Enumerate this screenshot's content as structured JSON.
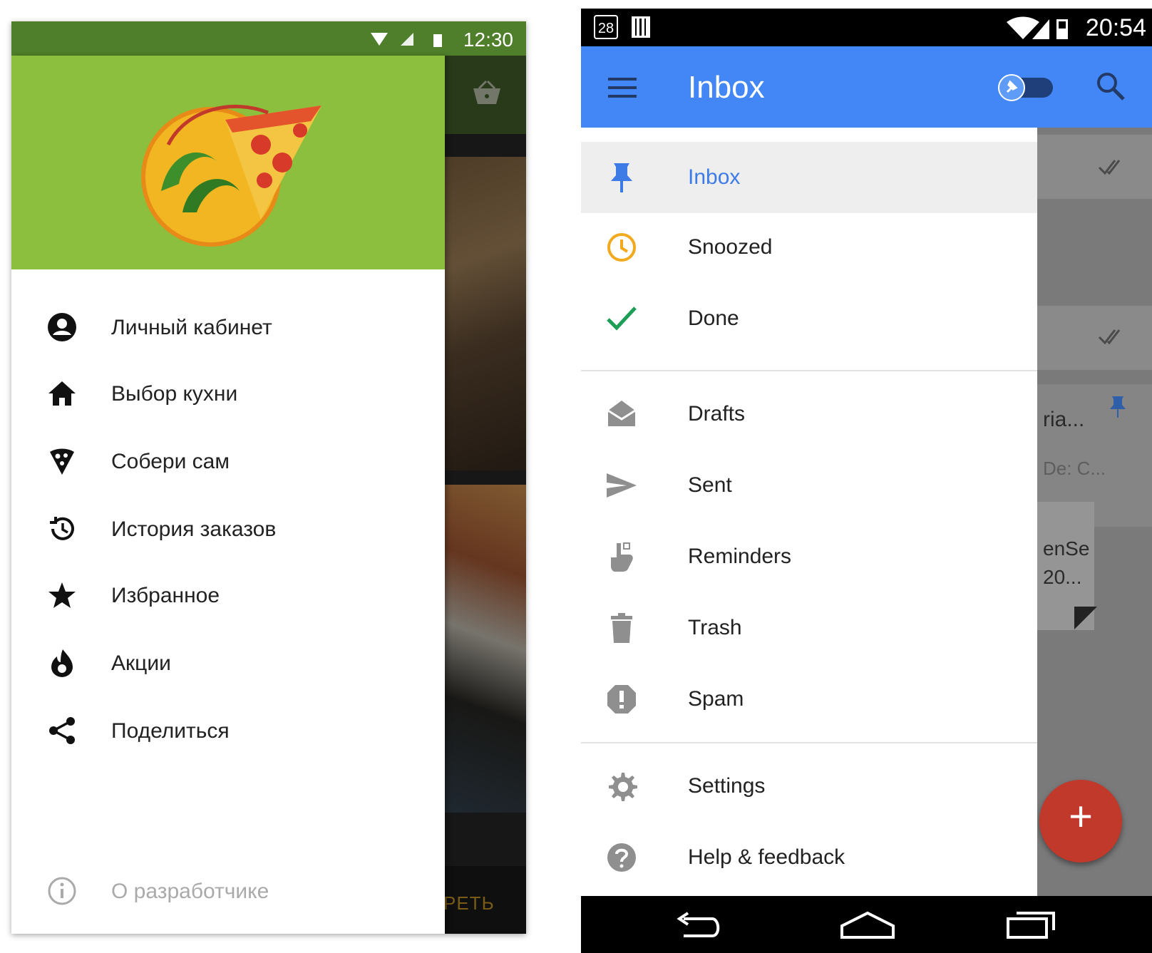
{
  "left_app": {
    "status_time": "12:30",
    "menu": [
      {
        "label": "Личный кабинет",
        "icon": "account-circle-icon"
      },
      {
        "label": "Выбор кухни",
        "icon": "home-icon"
      },
      {
        "label": "Собери сам",
        "icon": "pizza-slice-icon"
      },
      {
        "label": "История заказов",
        "icon": "history-icon"
      },
      {
        "label": "Избранное",
        "icon": "star-icon"
      },
      {
        "label": "Акции",
        "icon": "fire-icon"
      },
      {
        "label": "Поделиться",
        "icon": "share-icon"
      }
    ],
    "about_label": "О разработчике",
    "background_button_text": "РЕТЬ",
    "colors": {
      "header": "#8bbf3d",
      "statusbar": "#4f7f2a"
    }
  },
  "right_app": {
    "status_time": "20:54",
    "status_date_badge": "28",
    "title": "Inbox",
    "menu_primary": [
      {
        "label": "Inbox",
        "icon": "pin-icon",
        "selected": true
      },
      {
        "label": "Snoozed",
        "icon": "clock-icon"
      },
      {
        "label": "Done",
        "icon": "check-icon"
      }
    ],
    "menu_folders": [
      {
        "label": "Drafts",
        "icon": "drafts-icon"
      },
      {
        "label": "Sent",
        "icon": "send-icon"
      },
      {
        "label": "Reminders",
        "icon": "reminder-hand-icon"
      },
      {
        "label": "Trash",
        "icon": "trash-icon"
      },
      {
        "label": "Spam",
        "icon": "spam-icon"
      }
    ],
    "menu_footer": [
      {
        "label": "Settings",
        "icon": "gear-icon"
      },
      {
        "label": "Help & feedback",
        "icon": "help-icon"
      }
    ],
    "background_snippets": [
      "ria...",
      "De: C...",
      "enSe",
      "20..."
    ],
    "fab_label": "+",
    "colors": {
      "appbar": "#4287f5",
      "selected_text": "#3d7be6",
      "fab": "#c0392b"
    }
  }
}
